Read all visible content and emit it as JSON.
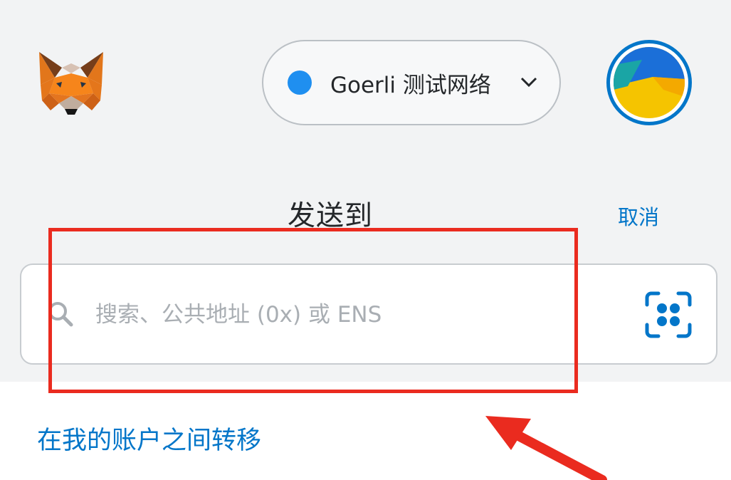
{
  "header": {
    "network": {
      "label": "Goerli 测试网络",
      "dot_color": "#1f8ff0"
    }
  },
  "send": {
    "title": "发送到",
    "cancel_label": "取消",
    "search": {
      "placeholder": "搜索、公共地址 (0x) 或 ENS",
      "value": ""
    },
    "transfer_link": "在我的账户之间转移"
  },
  "icons": {
    "logo": "metamask-fox-icon",
    "network_toggle": "chevron-down-icon",
    "account": "account-avatar-icon",
    "search": "search-icon",
    "scan": "qr-scan-icon"
  },
  "colors": {
    "link": "#0376c9",
    "annotation": "#ea2b1f",
    "header_bg": "#f2f3f4"
  }
}
